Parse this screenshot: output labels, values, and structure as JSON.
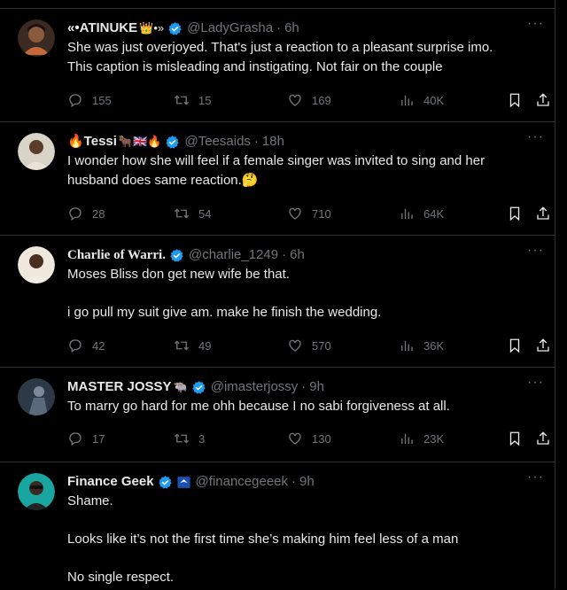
{
  "tweets": [
    {
      "name": "«•ATINUKE",
      "name_suffix": "👑•»",
      "handle": "@LadyGrasha",
      "time": "6h",
      "text": [
        "She was just overjoyed. That's just a reaction to a pleasant surprise imo.",
        "This caption is misleading and instigating. Not fair on the couple"
      ],
      "replies": "155",
      "retweets": "15",
      "likes": "169",
      "views": "40K",
      "avatar_color": "#c46a3a"
    },
    {
      "name": "🔥Tessi",
      "name_suffix": "🐂🇬🇧🔥",
      "handle": "@Teesaids",
      "time": "18h",
      "text": [
        "I wonder how she will feel if a female singer was invited to sing and her",
        "husband does same reaction.🤔"
      ],
      "replies": "28",
      "retweets": "54",
      "likes": "710",
      "views": "64K",
      "avatar_color": "#5b4a3a"
    },
    {
      "name": "Charlie of Warri.",
      "name_suffix": "",
      "handle": "@charlie_1249",
      "time": "6h",
      "text": [
        "Moses Bliss don get new wife be that.",
        "",
        "i go pull my suit give am. make he finish the wedding."
      ],
      "replies": "42",
      "retweets": "49",
      "likes": "570",
      "views": "36K",
      "avatar_color": "#e9e2d6"
    },
    {
      "name": "MASTER JOSSY",
      "name_suffix": "🐃",
      "handle": "@imasterjossy",
      "time": "9h",
      "text": [
        "To marry go hard for me ohh because I no sabi forgiveness at all."
      ],
      "replies": "17",
      "retweets": "3",
      "likes": "130",
      "views": "23K",
      "avatar_color": "#4a5a6a"
    },
    {
      "name": "Finance Geek",
      "name_suffix": "",
      "handle": "@financegeeek",
      "time": "9h",
      "text": [
        "Shame.",
        "",
        "Looks like it’s not the first time she’s making him feel less of a man",
        "",
        "No single respect."
      ],
      "replies": "",
      "retweets": "",
      "likes": "",
      "views": "",
      "avatar_color": "#1aa6a0"
    }
  ],
  "colors": {
    "background": "#000000",
    "text": "#e7e9ea",
    "muted": "#71767b",
    "verified": "#1d9bf0",
    "divider": "#2f3336"
  },
  "icons": [
    "reply-icon",
    "retweet-icon",
    "like-icon",
    "views-icon",
    "bookmark-icon",
    "share-icon",
    "verified-icon",
    "more-icon"
  ]
}
